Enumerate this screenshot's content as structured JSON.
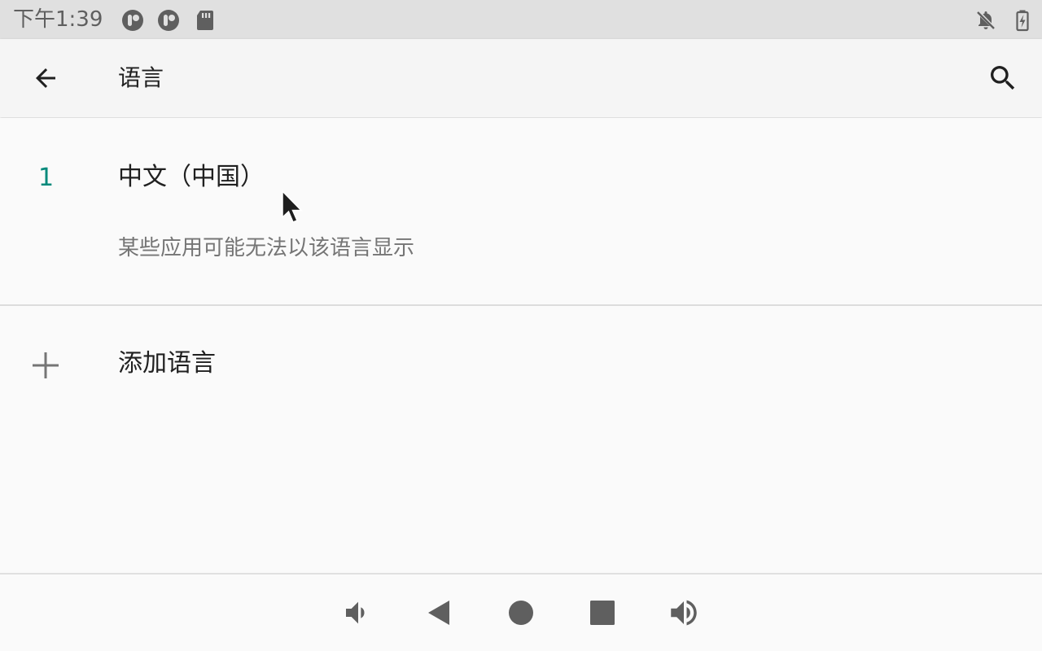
{
  "status_bar": {
    "time": "下午1:39",
    "icons": [
      "app-notification-icon",
      "app-notification-icon",
      "sd-card-icon",
      "notifications-off-icon",
      "battery-charging-icon"
    ]
  },
  "toolbar": {
    "title": "语言",
    "back_icon": "arrow-back-icon",
    "search_icon": "search-icon"
  },
  "languages": [
    {
      "index": "1",
      "name": "中文（中国）",
      "note": "某些应用可能无法以该语言显示"
    }
  ],
  "add_language": {
    "label": "添加语言",
    "icon": "plus-icon"
  },
  "nav_bar": {
    "buttons": [
      "volume-down-icon",
      "back-icon",
      "home-icon",
      "recents-icon",
      "volume-up-icon"
    ]
  },
  "colors": {
    "accent": "#00897b",
    "status_bar_bg": "#e0e0e0",
    "toolbar_bg": "#f5f5f5",
    "page_bg": "#fafafa"
  }
}
